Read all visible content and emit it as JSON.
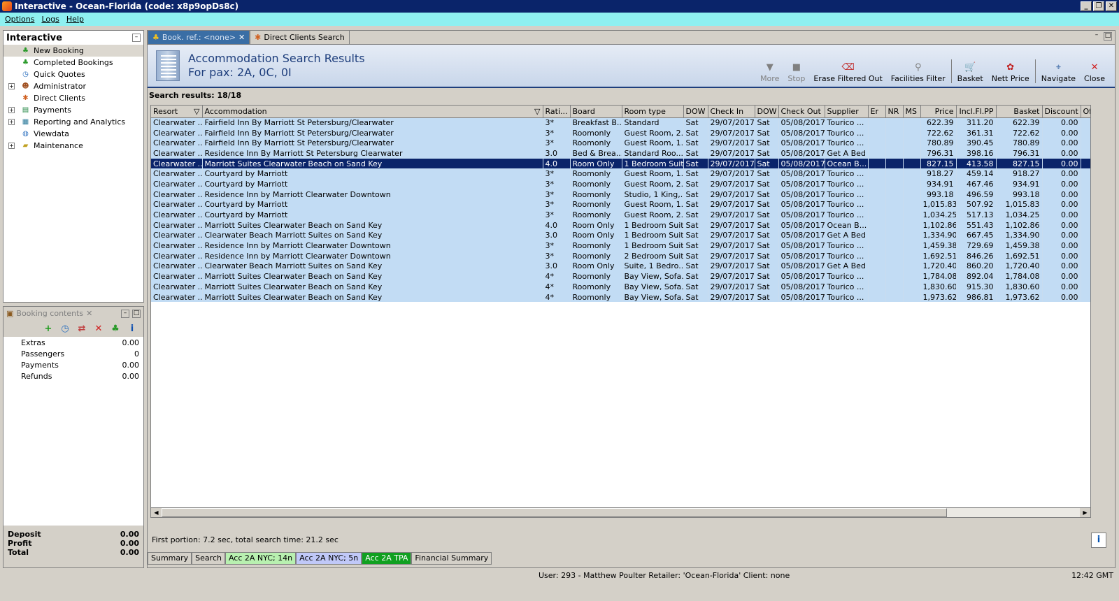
{
  "window": {
    "title": "Interactive - Ocean-Florida (code: x8p9opDs8c)",
    "btn_min": "_",
    "btn_max": "❐",
    "btn_close": "✕"
  },
  "menu": [
    "Options",
    "Logs",
    "Help"
  ],
  "left": {
    "title": "Interactive",
    "tree": [
      {
        "label": "New Booking",
        "icon": "palm-tree-icon",
        "expand": ""
      },
      {
        "label": "Completed Bookings",
        "icon": "palm-tree-icon",
        "expand": ""
      },
      {
        "label": "Quick Quotes",
        "icon": "clock-icon",
        "expand": ""
      },
      {
        "label": "Administrator",
        "icon": "person-icon",
        "expand": "+"
      },
      {
        "label": "Direct Clients",
        "icon": "person-star-icon",
        "expand": ""
      },
      {
        "label": "Payments",
        "icon": "payments-icon",
        "expand": "+"
      },
      {
        "label": "Reporting and Analytics",
        "icon": "report-icon",
        "expand": "+"
      },
      {
        "label": "Viewdata",
        "icon": "globe-icon",
        "expand": ""
      },
      {
        "label": "Maintenance",
        "icon": "folder-icon",
        "expand": "+"
      }
    ]
  },
  "booking": {
    "tab": "Booking contents",
    "items": [
      {
        "label": "Extras",
        "value": "0.00"
      },
      {
        "label": "Passengers",
        "value": "0"
      },
      {
        "label": "Payments",
        "value": "0.00"
      },
      {
        "label": "Refunds",
        "value": "0.00"
      }
    ],
    "totals": [
      {
        "label": "Deposit",
        "value": "0.00"
      },
      {
        "label": "Profit",
        "value": "0.00"
      },
      {
        "label": "Total",
        "value": "0.00"
      }
    ]
  },
  "tabs": {
    "t1": "Book. ref.: <none>",
    "t2": "Direct Clients Search"
  },
  "header": {
    "line1": "Accommodation Search Results",
    "line2": "For pax: 2A, 0C, 0I"
  },
  "toolbar": [
    {
      "label": "More",
      "icon": "▼",
      "disabled": true,
      "color": "#808080"
    },
    {
      "label": "Stop",
      "icon": "■",
      "disabled": true,
      "color": "#808080"
    },
    {
      "label": "Erase Filtered Out",
      "icon": "⌫",
      "disabled": false,
      "color": "#c03030"
    },
    {
      "label": "Facilities Filter",
      "icon": "⚲",
      "disabled": false,
      "color": "#808080"
    },
    {
      "label": "Basket",
      "icon": "🛒",
      "disabled": false,
      "color": "#505050",
      "sep": true
    },
    {
      "label": "Nett Price",
      "icon": "✿",
      "disabled": false,
      "color": "#c02020"
    },
    {
      "label": "Navigate",
      "icon": "⌖",
      "disabled": false,
      "color": "#3060a0",
      "sep": true
    },
    {
      "label": "Close",
      "icon": "✕",
      "disabled": false,
      "color": "#d02020"
    }
  ],
  "results_label": "Search results: 18/18",
  "columns": [
    "Resort",
    "Accommodation",
    "Rati...",
    "Board",
    "Room type",
    "DOW",
    "Check In",
    "DOW",
    "Check Out",
    "Supplier",
    "Er",
    "NR",
    "MS",
    "Price",
    "Incl.Fl.PP",
    "Basket",
    "Discount",
    "Of"
  ],
  "rows": [
    [
      "Clearwater ...",
      "Fairfield Inn By Marriott St Petersburg/Clearwater",
      "3*",
      "Breakfast B...",
      "Standard",
      "Sat",
      "29/07/2017",
      "Sat",
      "05/08/2017",
      "Tourico ...",
      "",
      "",
      "",
      "622.39",
      "311.20",
      "622.39",
      "0.00",
      ""
    ],
    [
      "Clearwater ...",
      "Fairfield Inn By Marriott St Petersburg/Clearwater",
      "3*",
      "Roomonly",
      "Guest Room, 2...",
      "Sat",
      "29/07/2017",
      "Sat",
      "05/08/2017",
      "Tourico ...",
      "",
      "",
      "",
      "722.62",
      "361.31",
      "722.62",
      "0.00",
      ""
    ],
    [
      "Clearwater ...",
      "Fairfield Inn By Marriott St Petersburg/Clearwater",
      "3*",
      "Roomonly",
      "Guest Room, 1...",
      "Sat",
      "29/07/2017",
      "Sat",
      "05/08/2017",
      "Tourico ...",
      "",
      "",
      "",
      "780.89",
      "390.45",
      "780.89",
      "0.00",
      ""
    ],
    [
      "Clearwater ...",
      "Residence Inn By Marriott St Petersburg Clearwater",
      "3.0",
      "Bed & Brea...",
      "Standard Roo...",
      "Sat",
      "29/07/2017",
      "Sat",
      "05/08/2017",
      "Get A Bed",
      "",
      "",
      "",
      "796.31",
      "398.16",
      "796.31",
      "0.00",
      ""
    ],
    [
      "Clearwater ...",
      "Marriott Suites Clearwater Beach on Sand Key",
      "4.0",
      "Room Only",
      "1 Bedroom Suite",
      "Sat",
      "29/07/2017",
      "Sat",
      "05/08/2017",
      "Ocean B...",
      "",
      "",
      "",
      "827.15",
      "413.58",
      "827.15",
      "0.00",
      ""
    ],
    [
      "Clearwater ...",
      "Courtyard by Marriott",
      "3*",
      "Roomonly",
      "Guest Room, 1...",
      "Sat",
      "29/07/2017",
      "Sat",
      "05/08/2017",
      "Tourico ...",
      "",
      "",
      "",
      "918.27",
      "459.14",
      "918.27",
      "0.00",
      ""
    ],
    [
      "Clearwater ...",
      "Courtyard by Marriott",
      "3*",
      "Roomonly",
      "Guest Room, 2...",
      "Sat",
      "29/07/2017",
      "Sat",
      "05/08/2017",
      "Tourico ...",
      "",
      "",
      "",
      "934.91",
      "467.46",
      "934.91",
      "0.00",
      ""
    ],
    [
      "Clearwater ...",
      "Residence Inn by Marriott Clearwater Downtown",
      "3*",
      "Roomonly",
      "Studio, 1 King,...",
      "Sat",
      "29/07/2017",
      "Sat",
      "05/08/2017",
      "Tourico ...",
      "",
      "",
      "",
      "993.18",
      "496.59",
      "993.18",
      "0.00",
      ""
    ],
    [
      "Clearwater ...",
      "Courtyard by Marriott",
      "3*",
      "Roomonly",
      "Guest Room, 1...",
      "Sat",
      "29/07/2017",
      "Sat",
      "05/08/2017",
      "Tourico ...",
      "",
      "",
      "",
      "1,015.83",
      "507.92",
      "1,015.83",
      "0.00",
      ""
    ],
    [
      "Clearwater ...",
      "Courtyard by Marriott",
      "3*",
      "Roomonly",
      "Guest Room, 2...",
      "Sat",
      "29/07/2017",
      "Sat",
      "05/08/2017",
      "Tourico ...",
      "",
      "",
      "",
      "1,034.25",
      "517.13",
      "1,034.25",
      "0.00",
      ""
    ],
    [
      "Clearwater ...",
      "Marriott Suites Clearwater Beach on Sand Key",
      "4.0",
      "Room Only",
      "1 Bedroom Suit...",
      "Sat",
      "29/07/2017",
      "Sat",
      "05/08/2017",
      "Ocean B...",
      "",
      "",
      "",
      "1,102.86",
      "551.43",
      "1,102.86",
      "0.00",
      ""
    ],
    [
      "Clearwater ...",
      "Clearwater Beach Marriott Suites on Sand Key",
      "3.0",
      "Room Only",
      "1 Bedroom Suit...",
      "Sat",
      "29/07/2017",
      "Sat",
      "05/08/2017",
      "Get A Bed",
      "",
      "",
      "",
      "1,334.90",
      "667.45",
      "1,334.90",
      "0.00",
      ""
    ],
    [
      "Clearwater ...",
      "Residence Inn by Marriott Clearwater Downtown",
      "3*",
      "Roomonly",
      "1 Bedroom Suit...",
      "Sat",
      "29/07/2017",
      "Sat",
      "05/08/2017",
      "Tourico ...",
      "",
      "",
      "",
      "1,459.38",
      "729.69",
      "1,459.38",
      "0.00",
      ""
    ],
    [
      "Clearwater ...",
      "Residence Inn by Marriott Clearwater Downtown",
      "3*",
      "Roomonly",
      "2 Bedroom Suite",
      "Sat",
      "29/07/2017",
      "Sat",
      "05/08/2017",
      "Tourico ...",
      "",
      "",
      "",
      "1,692.51",
      "846.26",
      "1,692.51",
      "0.00",
      ""
    ],
    [
      "Clearwater ...",
      "Clearwater Beach Marriott Suites on Sand Key",
      "3.0",
      "Room Only",
      "Suite, 1 Bedro...",
      "Sat",
      "29/07/2017",
      "Sat",
      "05/08/2017",
      "Get A Bed",
      "",
      "",
      "",
      "1,720.40",
      "860.20",
      "1,720.40",
      "0.00",
      ""
    ],
    [
      "Clearwater ...",
      "Marriott Suites Clearwater Beach on Sand Key",
      "4*",
      "Roomonly",
      "Bay View, Sofa...",
      "Sat",
      "29/07/2017",
      "Sat",
      "05/08/2017",
      "Tourico ...",
      "",
      "",
      "",
      "1,784.08",
      "892.04",
      "1,784.08",
      "0.00",
      ""
    ],
    [
      "Clearwater ...",
      "Marriott Suites Clearwater Beach on Sand Key",
      "4*",
      "Roomonly",
      "Bay View, Sofa...",
      "Sat",
      "29/07/2017",
      "Sat",
      "05/08/2017",
      "Tourico ...",
      "",
      "",
      "",
      "1,830.60",
      "915.30",
      "1,830.60",
      "0.00",
      ""
    ],
    [
      "Clearwater ...",
      "Marriott Suites Clearwater Beach on Sand Key",
      "4*",
      "Roomonly",
      "Bay View, Sofa...",
      "Sat",
      "29/07/2017",
      "Sat",
      "05/08/2017",
      "Tourico ...",
      "",
      "",
      "",
      "1,973.62",
      "986.81",
      "1,973.62",
      "0.00",
      ""
    ]
  ],
  "selected_row": 4,
  "status_text": "First portion: 7.2 sec, total search time: 21.2 sec",
  "bottom_tabs": [
    {
      "label": "Summary",
      "bg": "#d4d0c8",
      "color": "#000"
    },
    {
      "label": "Search",
      "bg": "#d4d0c8",
      "color": "#000"
    },
    {
      "label": "Acc 2A NYC; 14n",
      "bg": "#b8f0b0",
      "color": "#000"
    },
    {
      "label": "Acc 2A NYC; 5n",
      "bg": "#c0c8f8",
      "color": "#000"
    },
    {
      "label": "Acc 2A TPA",
      "bg": "#10a020",
      "color": "#fff"
    },
    {
      "label": "Financial Summary",
      "bg": "#d4d0c8",
      "color": "#000"
    }
  ],
  "statusbar": {
    "main": "User: 293 - Matthew Poulter    Retailer: 'Ocean-Florida'    Client: none",
    "time": "12:42 GMT"
  }
}
